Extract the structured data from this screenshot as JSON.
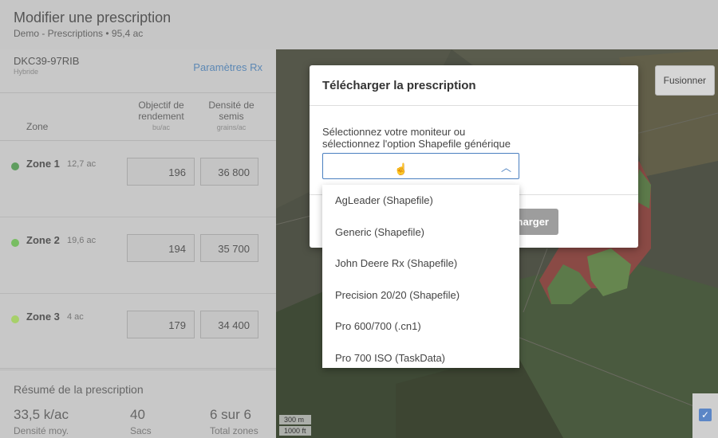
{
  "header": {
    "title": "Modifier une prescription",
    "subtitle": "Demo - Prescriptions • 95,4 ac"
  },
  "hybrid": {
    "name": "DKC39-97RIB",
    "type": "Hybride",
    "rx_link": "Paramètres Rx"
  },
  "columns": {
    "zone": "Zone",
    "yield_line1": "Objectif de",
    "yield_line2": "rendement",
    "yield_unit": "bu/ac",
    "density_line1": "Densité de",
    "density_line2": "semis",
    "density_unit": "grains/ac"
  },
  "zones": [
    {
      "name": "Zone 1",
      "area": "12,7 ac",
      "yield": "196",
      "density": "36 800",
      "color": "#5f9d5f"
    },
    {
      "name": "Zone 2",
      "area": "19,6 ac",
      "yield": "194",
      "density": "35 700",
      "color": "#78bd62"
    },
    {
      "name": "Zone 3",
      "area": "4 ac",
      "yield": "179",
      "density": "34 400",
      "color": "#a7d06a"
    }
  ],
  "summary": {
    "title": "Résumé de la prescription",
    "stats": [
      {
        "value": "33,5 k/ac",
        "label": "Densité moy."
      },
      {
        "value": "40",
        "label": "Sacs"
      },
      {
        "value": "6 sur 6",
        "label": "Total zones"
      }
    ]
  },
  "map": {
    "merge_button": "Fusionner",
    "scale_m": "300 m",
    "scale_ft": "1000 ft"
  },
  "modal": {
    "title": "Télécharger la prescription",
    "label_line1": "Sélectionnez votre moniteur ou",
    "label_line2": "sélectionnez l'option Shapefile générique",
    "select_value": "",
    "download_partial": "harger"
  },
  "dropdown": {
    "options": [
      "AgLeader (Shapefile)",
      "Generic (Shapefile)",
      "John Deere Rx (Shapefile)",
      "Precision 20/20 (Shapefile)",
      "Pro 600/700 (.cn1)",
      "Pro 700 ISO (TaskData)"
    ]
  }
}
